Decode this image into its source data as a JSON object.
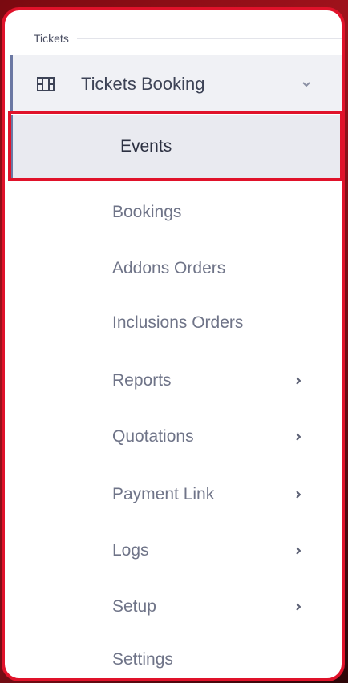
{
  "section": {
    "title": "Tickets"
  },
  "group": {
    "label": "Tickets Booking",
    "icon": "film-icon",
    "toggle_icon": "chevron-down-icon"
  },
  "active_item": {
    "label": "Events"
  },
  "menu": {
    "items": [
      {
        "label": "Bookings",
        "has_submenu": false
      },
      {
        "label": "Addons Orders",
        "has_submenu": false
      },
      {
        "label": "Inclusions Orders",
        "has_submenu": false
      },
      {
        "label": "Reports",
        "has_submenu": true
      },
      {
        "label": "Quotations",
        "has_submenu": true
      },
      {
        "label": "Payment Link",
        "has_submenu": true
      },
      {
        "label": "Logs",
        "has_submenu": true
      },
      {
        "label": "Setup",
        "has_submenu": true
      },
      {
        "label": "Settings",
        "has_submenu": false
      }
    ]
  },
  "colors": {
    "highlight": "#e0122a",
    "active_indicator": "#6b78a3",
    "active_bg": "#e9eaf0"
  }
}
